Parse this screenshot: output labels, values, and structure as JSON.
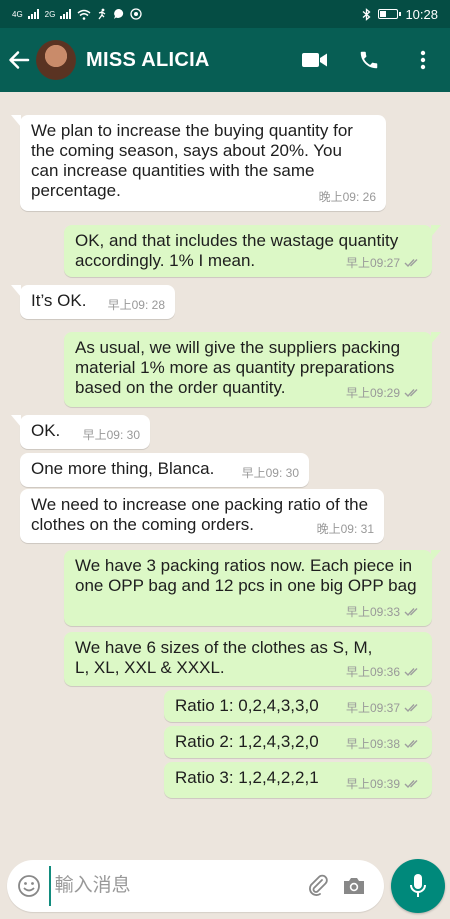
{
  "status_bar": {
    "signal_1": "4G",
    "signal_2": "2G",
    "time": "10:28"
  },
  "app_bar": {
    "contact_name": "MISS ALICIA",
    "icons": [
      "back-arrow-icon",
      "avatar",
      "video-call-icon",
      "phone-icon",
      "more-vert-icon"
    ]
  },
  "messages": [
    {
      "direction": "in",
      "text": "We plan to increase the buying quantity for the coming season, says about 20%. You can increase quantities with the same percentage.",
      "time": "晚上09: 26"
    },
    {
      "direction": "out",
      "text": "OK, and that includes the wastage quantity accordingly. 1% I mean.",
      "time": "早上09:27",
      "status": "read"
    },
    {
      "direction": "in",
      "text": "It’s OK.",
      "time": "早上09: 28"
    },
    {
      "direction": "out",
      "text": "As usual, we will give the suppliers packing material 1% more as quantity preparations based on the order quantity.",
      "time": "早上09:29",
      "status": "read"
    },
    {
      "direction": "in",
      "text": "OK.",
      "time": "早上09: 30"
    },
    {
      "direction": "in",
      "text": "One more thing, Blanca.",
      "time": "早上09: 30"
    },
    {
      "direction": "in",
      "text": "We need to increase one packing ratio of the clothes on the coming orders.",
      "time": "晚上09: 31"
    },
    {
      "direction": "out",
      "text": "We have 3 packing ratios now. Each piece in one OPP bag and 12 pcs in one big OPP bag",
      "time": "早上09:33",
      "status": "read"
    },
    {
      "direction": "out",
      "text": "We have 6 sizes of the clothes as S, M, L, XL, XXL & XXXL.",
      "time": "早上09:36",
      "status": "read"
    },
    {
      "direction": "out",
      "text": "Ratio 1: 0,2,4,3,3,0",
      "time": "早上09:37",
      "status": "read"
    },
    {
      "direction": "out",
      "text": "Ratio 2: 1,2,4,3,2,0",
      "time": "早上09:38",
      "status": "read"
    },
    {
      "direction": "out",
      "text": "Ratio 3: 1,2,4,2,2,1",
      "time": "早上09:39",
      "status": "read"
    }
  ],
  "composer": {
    "placeholder": "輸入消息",
    "icons": [
      "emoji-icon",
      "attach-icon",
      "camera-icon",
      "mic-icon"
    ]
  },
  "colors": {
    "header": "#075e54",
    "status_bar": "#054d44",
    "chat_bg": "#ece5dd",
    "outgoing_bubble": "#dcf8c6",
    "incoming_bubble": "#ffffff",
    "read_ticks": "#9e9e9e",
    "mic_button": "#00897b"
  }
}
